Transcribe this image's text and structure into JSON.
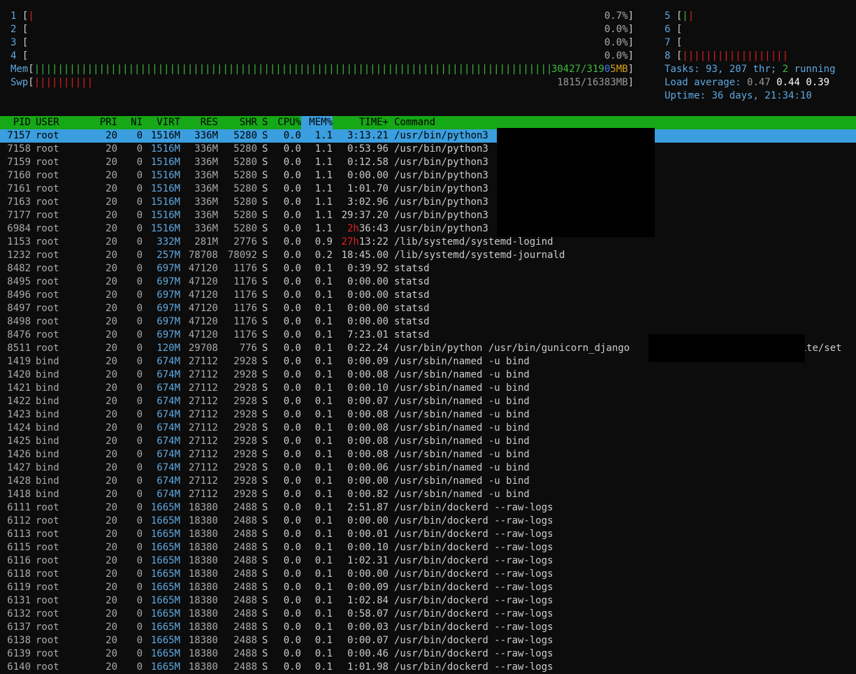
{
  "cpu_left": [
    {
      "label": "1",
      "usage": "0.7%",
      "bars": "|",
      "bars_color": "red"
    },
    {
      "label": "2",
      "usage": "0.0%",
      "bars": "",
      "bars_color": "red"
    },
    {
      "label": "3",
      "usage": "0.0%",
      "bars": "",
      "bars_color": "red"
    },
    {
      "label": "4",
      "usage": "0.0%",
      "bars": "",
      "bars_color": "red"
    }
  ],
  "cpu_right": [
    {
      "label": "5",
      "bars_green": "|",
      "bars_red": "|"
    },
    {
      "label": "6",
      "bars_green": "",
      "bars_red": ""
    },
    {
      "label": "7",
      "bars_green": "",
      "bars_red": ""
    },
    {
      "label": "8",
      "bars_green": "",
      "bars_red": "||||||||||||||||||"
    }
  ],
  "memory": {
    "label": "Mem",
    "bars": "||||||||||||||||||||||||||||||||||||||||||||||||||||||||||||||||||||||||||||||||||||||||||||||||||||||||||",
    "used": "30427",
    "total_a": "/319",
    "total_b": "0",
    "total_c": "5MB"
  },
  "swap": {
    "label": "Swp",
    "bars": "||||||||||",
    "value": "1815/16383MB"
  },
  "stats": {
    "tasks_label": "Tasks:",
    "tasks": "93,",
    "thr": "207",
    "thr_label": "thr;",
    "running": "2",
    "running_label": "running",
    "load_label": "Load average:",
    "load1": "0.47",
    "load5": "0.44",
    "load15": "0.39",
    "uptime_label": "Uptime:",
    "uptime": "36 days, 21:34:10"
  },
  "columns": {
    "pid": "PID",
    "user": "USER",
    "pri": "PRI",
    "ni": "NI",
    "virt": "VIRT",
    "res": "RES",
    "shr": "SHR",
    "s": "S",
    "cpu": "CPU%",
    "mem": "MEM%",
    "time": "TIME+",
    "command": "Command"
  },
  "colors": {
    "header_bg": "#16a816",
    "selection": "#3b9ede",
    "virt_hl": "#3b78ff",
    "red": "#e02020"
  },
  "processes": [
    {
      "pid": "7157",
      "user": "root",
      "pri": "20",
      "ni": "0",
      "virt": "1516M",
      "res": "336M",
      "shr": "5280",
      "s": "S",
      "cpu": "0.0",
      "mem": "1.1",
      "time": "3:13.21",
      "cmd": "/usr/bin/python3",
      "selected": true
    },
    {
      "pid": "7158",
      "user": "root",
      "pri": "20",
      "ni": "0",
      "virt": "1516M",
      "res": "336M",
      "shr": "5280",
      "s": "S",
      "cpu": "0.0",
      "mem": "1.1",
      "time": "0:53.96",
      "cmd": "/usr/bin/python3"
    },
    {
      "pid": "7159",
      "user": "root",
      "pri": "20",
      "ni": "0",
      "virt": "1516M",
      "res": "336M",
      "shr": "5280",
      "s": "S",
      "cpu": "0.0",
      "mem": "1.1",
      "time": "0:12.58",
      "cmd": "/usr/bin/python3"
    },
    {
      "pid": "7160",
      "user": "root",
      "pri": "20",
      "ni": "0",
      "virt": "1516M",
      "res": "336M",
      "shr": "5280",
      "s": "S",
      "cpu": "0.0",
      "mem": "1.1",
      "time": "0:00.00",
      "cmd": "/usr/bin/python3"
    },
    {
      "pid": "7161",
      "user": "root",
      "pri": "20",
      "ni": "0",
      "virt": "1516M",
      "res": "336M",
      "shr": "5280",
      "s": "S",
      "cpu": "0.0",
      "mem": "1.1",
      "time": "1:01.70",
      "cmd": "/usr/bin/python3"
    },
    {
      "pid": "7163",
      "user": "root",
      "pri": "20",
      "ni": "0",
      "virt": "1516M",
      "res": "336M",
      "shr": "5280",
      "s": "S",
      "cpu": "0.0",
      "mem": "1.1",
      "time": "3:02.96",
      "cmd": "/usr/bin/python3"
    },
    {
      "pid": "7177",
      "user": "root",
      "pri": "20",
      "ni": "0",
      "virt": "1516M",
      "res": "336M",
      "shr": "5280",
      "s": "S",
      "cpu": "0.0",
      "mem": "1.1",
      "time": "29:37.20",
      "cmd": "/usr/bin/python3"
    },
    {
      "pid": "6984",
      "user": "root",
      "pri": "20",
      "ni": "0",
      "virt": "1516M",
      "res": "336M",
      "shr": "5280",
      "s": "S",
      "cpu": "0.0",
      "mem": "1.1",
      "time_red": "2h",
      "time": "36:43",
      "cmd": "/usr/bin/python3"
    },
    {
      "pid": "1153",
      "user": "root",
      "pri": "20",
      "ni": "0",
      "virt": "332M",
      "res": "281M",
      "shr": "2776",
      "s": "S",
      "cpu": "0.0",
      "mem": "0.9",
      "time_red": "27h",
      "time": "13:22",
      "cmd": "/lib/systemd/systemd-logind"
    },
    {
      "pid": "1232",
      "user": "root",
      "pri": "20",
      "ni": "0",
      "virt": "257M",
      "res": "78708",
      "shr": "78092",
      "s": "S",
      "cpu": "0.0",
      "mem": "0.2",
      "time": "18:45.00",
      "cmd": "/lib/systemd/systemd-journald"
    },
    {
      "pid": "8482",
      "user": "root",
      "pri": "20",
      "ni": "0",
      "virt": "697M",
      "res": "47120",
      "shr": "1176",
      "s": "S",
      "cpu": "0.0",
      "mem": "0.1",
      "time": "0:39.92",
      "cmd": "statsd"
    },
    {
      "pid": "8495",
      "user": "root",
      "pri": "20",
      "ni": "0",
      "virt": "697M",
      "res": "47120",
      "shr": "1176",
      "s": "S",
      "cpu": "0.0",
      "mem": "0.1",
      "time": "0:00.00",
      "cmd": "statsd"
    },
    {
      "pid": "8496",
      "user": "root",
      "pri": "20",
      "ni": "0",
      "virt": "697M",
      "res": "47120",
      "shr": "1176",
      "s": "S",
      "cpu": "0.0",
      "mem": "0.1",
      "time": "0:00.00",
      "cmd": "statsd"
    },
    {
      "pid": "8497",
      "user": "root",
      "pri": "20",
      "ni": "0",
      "virt": "697M",
      "res": "47120",
      "shr": "1176",
      "s": "S",
      "cpu": "0.0",
      "mem": "0.1",
      "time": "0:00.00",
      "cmd": "statsd"
    },
    {
      "pid": "8498",
      "user": "root",
      "pri": "20",
      "ni": "0",
      "virt": "697M",
      "res": "47120",
      "shr": "1176",
      "s": "S",
      "cpu": "0.0",
      "mem": "0.1",
      "time": "0:00.00",
      "cmd": "statsd"
    },
    {
      "pid": "8476",
      "user": "root",
      "pri": "20",
      "ni": "0",
      "virt": "697M",
      "res": "47120",
      "shr": "1176",
      "s": "S",
      "cpu": "0.0",
      "mem": "0.1",
      "time": "7:23.01",
      "cmd": "statsd"
    },
    {
      "pid": "8511",
      "user": "root",
      "pri": "20",
      "ni": "0",
      "virt": "120M",
      "res": "29708",
      "shr": "776",
      "s": "S",
      "cpu": "0.0",
      "mem": "0.1",
      "time": "0:22.24",
      "cmd": "/usr/bin/python /usr/bin/gunicorn_django                           phite/set"
    },
    {
      "pid": "1419",
      "user": "bind",
      "pri": "20",
      "ni": "0",
      "virt": "674M",
      "res": "27112",
      "shr": "2928",
      "s": "S",
      "cpu": "0.0",
      "mem": "0.1",
      "time": "0:00.09",
      "cmd": "/usr/sbin/named -u bind"
    },
    {
      "pid": "1420",
      "user": "bind",
      "pri": "20",
      "ni": "0",
      "virt": "674M",
      "res": "27112",
      "shr": "2928",
      "s": "S",
      "cpu": "0.0",
      "mem": "0.1",
      "time": "0:00.08",
      "cmd": "/usr/sbin/named -u bind"
    },
    {
      "pid": "1421",
      "user": "bind",
      "pri": "20",
      "ni": "0",
      "virt": "674M",
      "res": "27112",
      "shr": "2928",
      "s": "S",
      "cpu": "0.0",
      "mem": "0.1",
      "time": "0:00.10",
      "cmd": "/usr/sbin/named -u bind"
    },
    {
      "pid": "1422",
      "user": "bind",
      "pri": "20",
      "ni": "0",
      "virt": "674M",
      "res": "27112",
      "shr": "2928",
      "s": "S",
      "cpu": "0.0",
      "mem": "0.1",
      "time": "0:00.07",
      "cmd": "/usr/sbin/named -u bind"
    },
    {
      "pid": "1423",
      "user": "bind",
      "pri": "20",
      "ni": "0",
      "virt": "674M",
      "res": "27112",
      "shr": "2928",
      "s": "S",
      "cpu": "0.0",
      "mem": "0.1",
      "time": "0:00.08",
      "cmd": "/usr/sbin/named -u bind"
    },
    {
      "pid": "1424",
      "user": "bind",
      "pri": "20",
      "ni": "0",
      "virt": "674M",
      "res": "27112",
      "shr": "2928",
      "s": "S",
      "cpu": "0.0",
      "mem": "0.1",
      "time": "0:00.08",
      "cmd": "/usr/sbin/named -u bind"
    },
    {
      "pid": "1425",
      "user": "bind",
      "pri": "20",
      "ni": "0",
      "virt": "674M",
      "res": "27112",
      "shr": "2928",
      "s": "S",
      "cpu": "0.0",
      "mem": "0.1",
      "time": "0:00.08",
      "cmd": "/usr/sbin/named -u bind"
    },
    {
      "pid": "1426",
      "user": "bind",
      "pri": "20",
      "ni": "0",
      "virt": "674M",
      "res": "27112",
      "shr": "2928",
      "s": "S",
      "cpu": "0.0",
      "mem": "0.1",
      "time": "0:00.08",
      "cmd": "/usr/sbin/named -u bind"
    },
    {
      "pid": "1427",
      "user": "bind",
      "pri": "20",
      "ni": "0",
      "virt": "674M",
      "res": "27112",
      "shr": "2928",
      "s": "S",
      "cpu": "0.0",
      "mem": "0.1",
      "time": "0:00.06",
      "cmd": "/usr/sbin/named -u bind"
    },
    {
      "pid": "1428",
      "user": "bind",
      "pri": "20",
      "ni": "0",
      "virt": "674M",
      "res": "27112",
      "shr": "2928",
      "s": "S",
      "cpu": "0.0",
      "mem": "0.1",
      "time": "0:00.00",
      "cmd": "/usr/sbin/named -u bind"
    },
    {
      "pid": "1418",
      "user": "bind",
      "pri": "20",
      "ni": "0",
      "virt": "674M",
      "res": "27112",
      "shr": "2928",
      "s": "S",
      "cpu": "0.0",
      "mem": "0.1",
      "time": "0:00.82",
      "cmd": "/usr/sbin/named -u bind"
    },
    {
      "pid": "6111",
      "user": "root",
      "pri": "20",
      "ni": "0",
      "virt": "1665M",
      "res": "18380",
      "shr": "2488",
      "s": "S",
      "cpu": "0.0",
      "mem": "0.1",
      "time": "2:51.87",
      "cmd": "/usr/bin/dockerd --raw-logs"
    },
    {
      "pid": "6112",
      "user": "root",
      "pri": "20",
      "ni": "0",
      "virt": "1665M",
      "res": "18380",
      "shr": "2488",
      "s": "S",
      "cpu": "0.0",
      "mem": "0.1",
      "time": "0:00.00",
      "cmd": "/usr/bin/dockerd --raw-logs"
    },
    {
      "pid": "6113",
      "user": "root",
      "pri": "20",
      "ni": "0",
      "virt": "1665M",
      "res": "18380",
      "shr": "2488",
      "s": "S",
      "cpu": "0.0",
      "mem": "0.1",
      "time": "0:00.01",
      "cmd": "/usr/bin/dockerd --raw-logs"
    },
    {
      "pid": "6115",
      "user": "root",
      "pri": "20",
      "ni": "0",
      "virt": "1665M",
      "res": "18380",
      "shr": "2488",
      "s": "S",
      "cpu": "0.0",
      "mem": "0.1",
      "time": "0:00.10",
      "cmd": "/usr/bin/dockerd --raw-logs"
    },
    {
      "pid": "6116",
      "user": "root",
      "pri": "20",
      "ni": "0",
      "virt": "1665M",
      "res": "18380",
      "shr": "2488",
      "s": "S",
      "cpu": "0.0",
      "mem": "0.1",
      "time": "1:02.31",
      "cmd": "/usr/bin/dockerd --raw-logs"
    },
    {
      "pid": "6118",
      "user": "root",
      "pri": "20",
      "ni": "0",
      "virt": "1665M",
      "res": "18380",
      "shr": "2488",
      "s": "S",
      "cpu": "0.0",
      "mem": "0.1",
      "time": "0:00.00",
      "cmd": "/usr/bin/dockerd --raw-logs"
    },
    {
      "pid": "6119",
      "user": "root",
      "pri": "20",
      "ni": "0",
      "virt": "1665M",
      "res": "18380",
      "shr": "2488",
      "s": "S",
      "cpu": "0.0",
      "mem": "0.1",
      "time": "0:00.09",
      "cmd": "/usr/bin/dockerd --raw-logs"
    },
    {
      "pid": "6131",
      "user": "root",
      "pri": "20",
      "ni": "0",
      "virt": "1665M",
      "res": "18380",
      "shr": "2488",
      "s": "S",
      "cpu": "0.0",
      "mem": "0.1",
      "time": "1:02.84",
      "cmd": "/usr/bin/dockerd --raw-logs"
    },
    {
      "pid": "6132",
      "user": "root",
      "pri": "20",
      "ni": "0",
      "virt": "1665M",
      "res": "18380",
      "shr": "2488",
      "s": "S",
      "cpu": "0.0",
      "mem": "0.1",
      "time": "0:58.07",
      "cmd": "/usr/bin/dockerd --raw-logs"
    },
    {
      "pid": "6137",
      "user": "root",
      "pri": "20",
      "ni": "0",
      "virt": "1665M",
      "res": "18380",
      "shr": "2488",
      "s": "S",
      "cpu": "0.0",
      "mem": "0.1",
      "time": "0:00.03",
      "cmd": "/usr/bin/dockerd --raw-logs"
    },
    {
      "pid": "6138",
      "user": "root",
      "pri": "20",
      "ni": "0",
      "virt": "1665M",
      "res": "18380",
      "shr": "2488",
      "s": "S",
      "cpu": "0.0",
      "mem": "0.1",
      "time": "0:00.07",
      "cmd": "/usr/bin/dockerd --raw-logs"
    },
    {
      "pid": "6139",
      "user": "root",
      "pri": "20",
      "ni": "0",
      "virt": "1665M",
      "res": "18380",
      "shr": "2488",
      "s": "S",
      "cpu": "0.0",
      "mem": "0.1",
      "time": "0:00.46",
      "cmd": "/usr/bin/dockerd --raw-logs"
    },
    {
      "pid": "6140",
      "user": "root",
      "pri": "20",
      "ni": "0",
      "virt": "1665M",
      "res": "18380",
      "shr": "2488",
      "s": "S",
      "cpu": "0.0",
      "mem": "0.1",
      "time": "1:01.98",
      "cmd": "/usr/bin/dockerd --raw-logs"
    }
  ]
}
